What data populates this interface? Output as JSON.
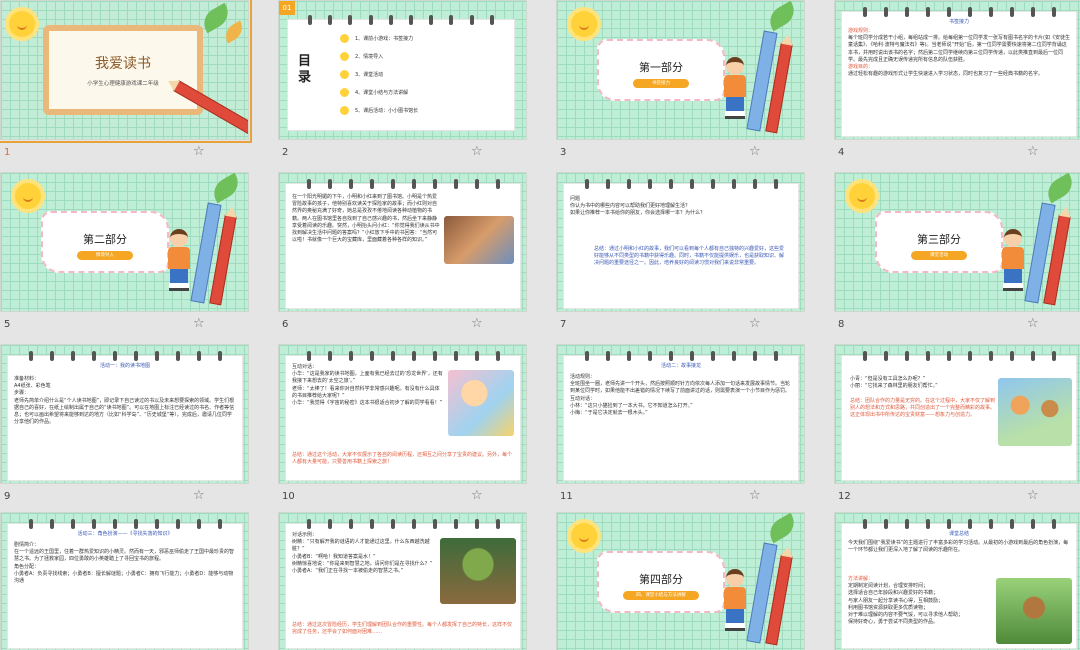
{
  "slides": [
    {
      "num": "1",
      "title": "我爱读书",
      "subtitle": "小学生心理健康游戏课二年级"
    },
    {
      "num": "2",
      "badge": "01",
      "toc_title": "目录",
      "toc": [
        "1、课前小游戏：书签接力",
        "2、情境导入",
        "3、课堂活动",
        "4、课堂小结与方法讲解",
        "5、课后活动：小小图书馆长"
      ]
    },
    {
      "num": "3",
      "section": "第一部分",
      "tag": "书签接力"
    },
    {
      "num": "4",
      "heading": "书签接力",
      "lines": [
        "游戏规则：",
        "每个班同学分成若干小组，每组站成一排。给每组第一位同学发一张写有图书名字的卡片(如《安徒生童话集》、《哈利·波特与魔法石》等)。当老师说“开始”后，第一位同学需要快速将第二位同学背诵这本书，并用时说出该书的名字；然后第二位同学继续向第三位同学传递，以此类推直到最后一位同学。最先完成且正确无误传递完所有信息的队伍获胜。",
        "游戏目的：",
        "通过轻松有趣的游戏形式让学生快速进入学习状态，同时也复习了一些经典书籍的名字。"
      ]
    },
    {
      "num": "5",
      "section": "第二部分",
      "tag": "情境导入"
    },
    {
      "num": "6",
      "lines": [
        "在一个阳光明媚的下午，小明和小红来到了图书馆。小明是个热爱冒险故事的孩子，他特别喜欢读关于探险家的故事；而小红则对自然界的奥秘充满了好奇，她总是孜孜不倦地阅读各种动植物的书籍。两人在图书馆里各自找到了自己感兴趣的书，然后坐下来静静享受着阅读的乐趣。突然，小明抬头问小红：“你觉得我们读从书中找到解决生活中问题的答案吗？”小红放下手中的书回答：“当然可以啦！书就像一个巨大的宝藏库，里面藏着各种各样的知识。”"
      ]
    },
    {
      "num": "7",
      "lines": [
        "问题",
        "你认为书中的哪些内容可以帮助我们更好地理解生活？",
        "如果让你推荐一本书给你的朋友，你会选择哪一本？为什么？"
      ],
      "summary": "总结：通过小明和小红的故事，我们可以看到每个人都有自己独特的兴趣爱好，这些爱好能够从不同类型的书籍中获得乐趣。同时，书籍不仅能提供娱乐，也是获取知识、解决问题的重要途径之一。因此，培养良好的阅读习惯对我们来说非常重要。"
    },
    {
      "num": "8",
      "section": "第三部分",
      "tag": "课堂活动"
    },
    {
      "num": "9",
      "heading": "活动一：我的读书地图",
      "lines": [
        "准备材料：",
        "A4纸张、彩色笔",
        "步骤：",
        "老师先简单介绍什么是“个人读书地图”，即记录下自己读过的书以及未来想要探索的领域。学生们根据自己的喜好，在纸上绘制出属于自己的“读书地图”。可以在地图上标注已经读过的书名、作者等信息；也可以画出希望将来能够到达的地方（比如“科学岛”、“历史城堡”等）。完成后，邀请几位同学分享他们的作品。"
      ]
    },
    {
      "num": "10",
      "lines": [
        "互动对话：",
        "小华：“这是我家的读书地图，上面有我已经去过的‘恐龙世界’，还有我接下来想去的‘太空之旅’。”",
        "老师：“太棒了！看来你对自然科学非常感兴趣呢。有没有什么具体的书目推荐给大家呢？”",
        "小华：“我觉得《宇宙的秘密》这本书很适合初步了解的同学看看！”"
      ],
      "summary": "总结：通过这个活动，大家不仅展示了各自的阅读历程，还相互之间分享了宝贵的建议。另外，每个人都有大量可能，只要善用书籍上探索之旅！"
    },
    {
      "num": "11",
      "heading": "活动二：故事接龙",
      "lines": [
        "活动规则：",
        "全班围坐一圈，老师先讲一个开头，然后按照顺时针方向依次每人添加一句话来发展故事情节。当轮到某位同学时，如果他能不出差错的情况下续写了前面讲过的话，则需要表演一个小节目作为惩罚。",
        "互动对话：",
        "小林：“这只小猫捡到了一本大书，它不知道怎么打开。”",
        "小梅：“于是它决定就去一根木头。”"
      ]
    },
    {
      "num": "12",
      "lines": [
        "小青：“但是没有工具怎么办呢？”",
        "小丽：“它找来了森林里的朋友们帮忙。”"
      ],
      "summary": "总结：团队合作的力量是无穷的。在这个过程中，大家不仅了解到别人的想法和方式和思路，共同创造出了一个完整而精彩的故事。这正体现出书中所传达的宝贵财富——想象力与创造力。"
    },
    {
      "num": "13",
      "heading": "活动三：角色扮演——《寻找失落的知识》",
      "lines": [
        "剧情简介：",
        "在一个遥远的王国里，住着一群热爱知识的小精灵。然而有一天，邪恶巫师偷走了王国中最珍贵的智慧之书。为了拯救家园，四位勇敢的小英雄踏上了寻回宝书的旅程。",
        "角色分配：",
        "小勇者A：负责寻找线索；小勇者B：擅长解谜题；小勇者C：拥有飞行能力；小勇者D：能够与动物沟通"
      ]
    },
    {
      "num": "14",
      "lines": [
        "对话示例：",
        "树精：“只有解开我的谜语的人才能通过这里。什么东西越洗越脏？”",
        "小勇者B：“啊哈！我知道答案是水！”",
        "树精惊喜地说：“你是来到智慧之地，请问你们是在寻找什么？”",
        "小勇者A：“我们正在寻找一本被偷走的智慧之书。”"
      ],
      "summary": "总结：通过这次冒险经历，学生们理解到团队合作的重要性。每个人都发挥了自己的特长，这样不仅完成了任务，还学会了如何面对困难……"
    },
    {
      "num": "15",
      "section": "第四部分",
      "tag": "四、课堂小结与方法讲解"
    },
    {
      "num": "16",
      "heading": "课堂总结",
      "lines": [
        "今天我们围绕“我爱读书”的主题进行了丰富多彩的学习活动。从最初的小游戏到最后的角色扮演，每一个环节都让我们更深入地了解了阅读的乐趣所在。",
        "方法讲解：",
        "定期制定阅读计划，合理安排时间；",
        "选择适合自己年龄段和兴趣爱好的书籍；",
        "与家人朋友一起分享读书心得，互相鼓励；",
        "利用图书馆资源获取更多优质读物；",
        "对于难以理解的内容不要气馁，可以寻求他人帮助；",
        "保持好奇心，勇于尝试不同类型的作品。"
      ]
    }
  ]
}
